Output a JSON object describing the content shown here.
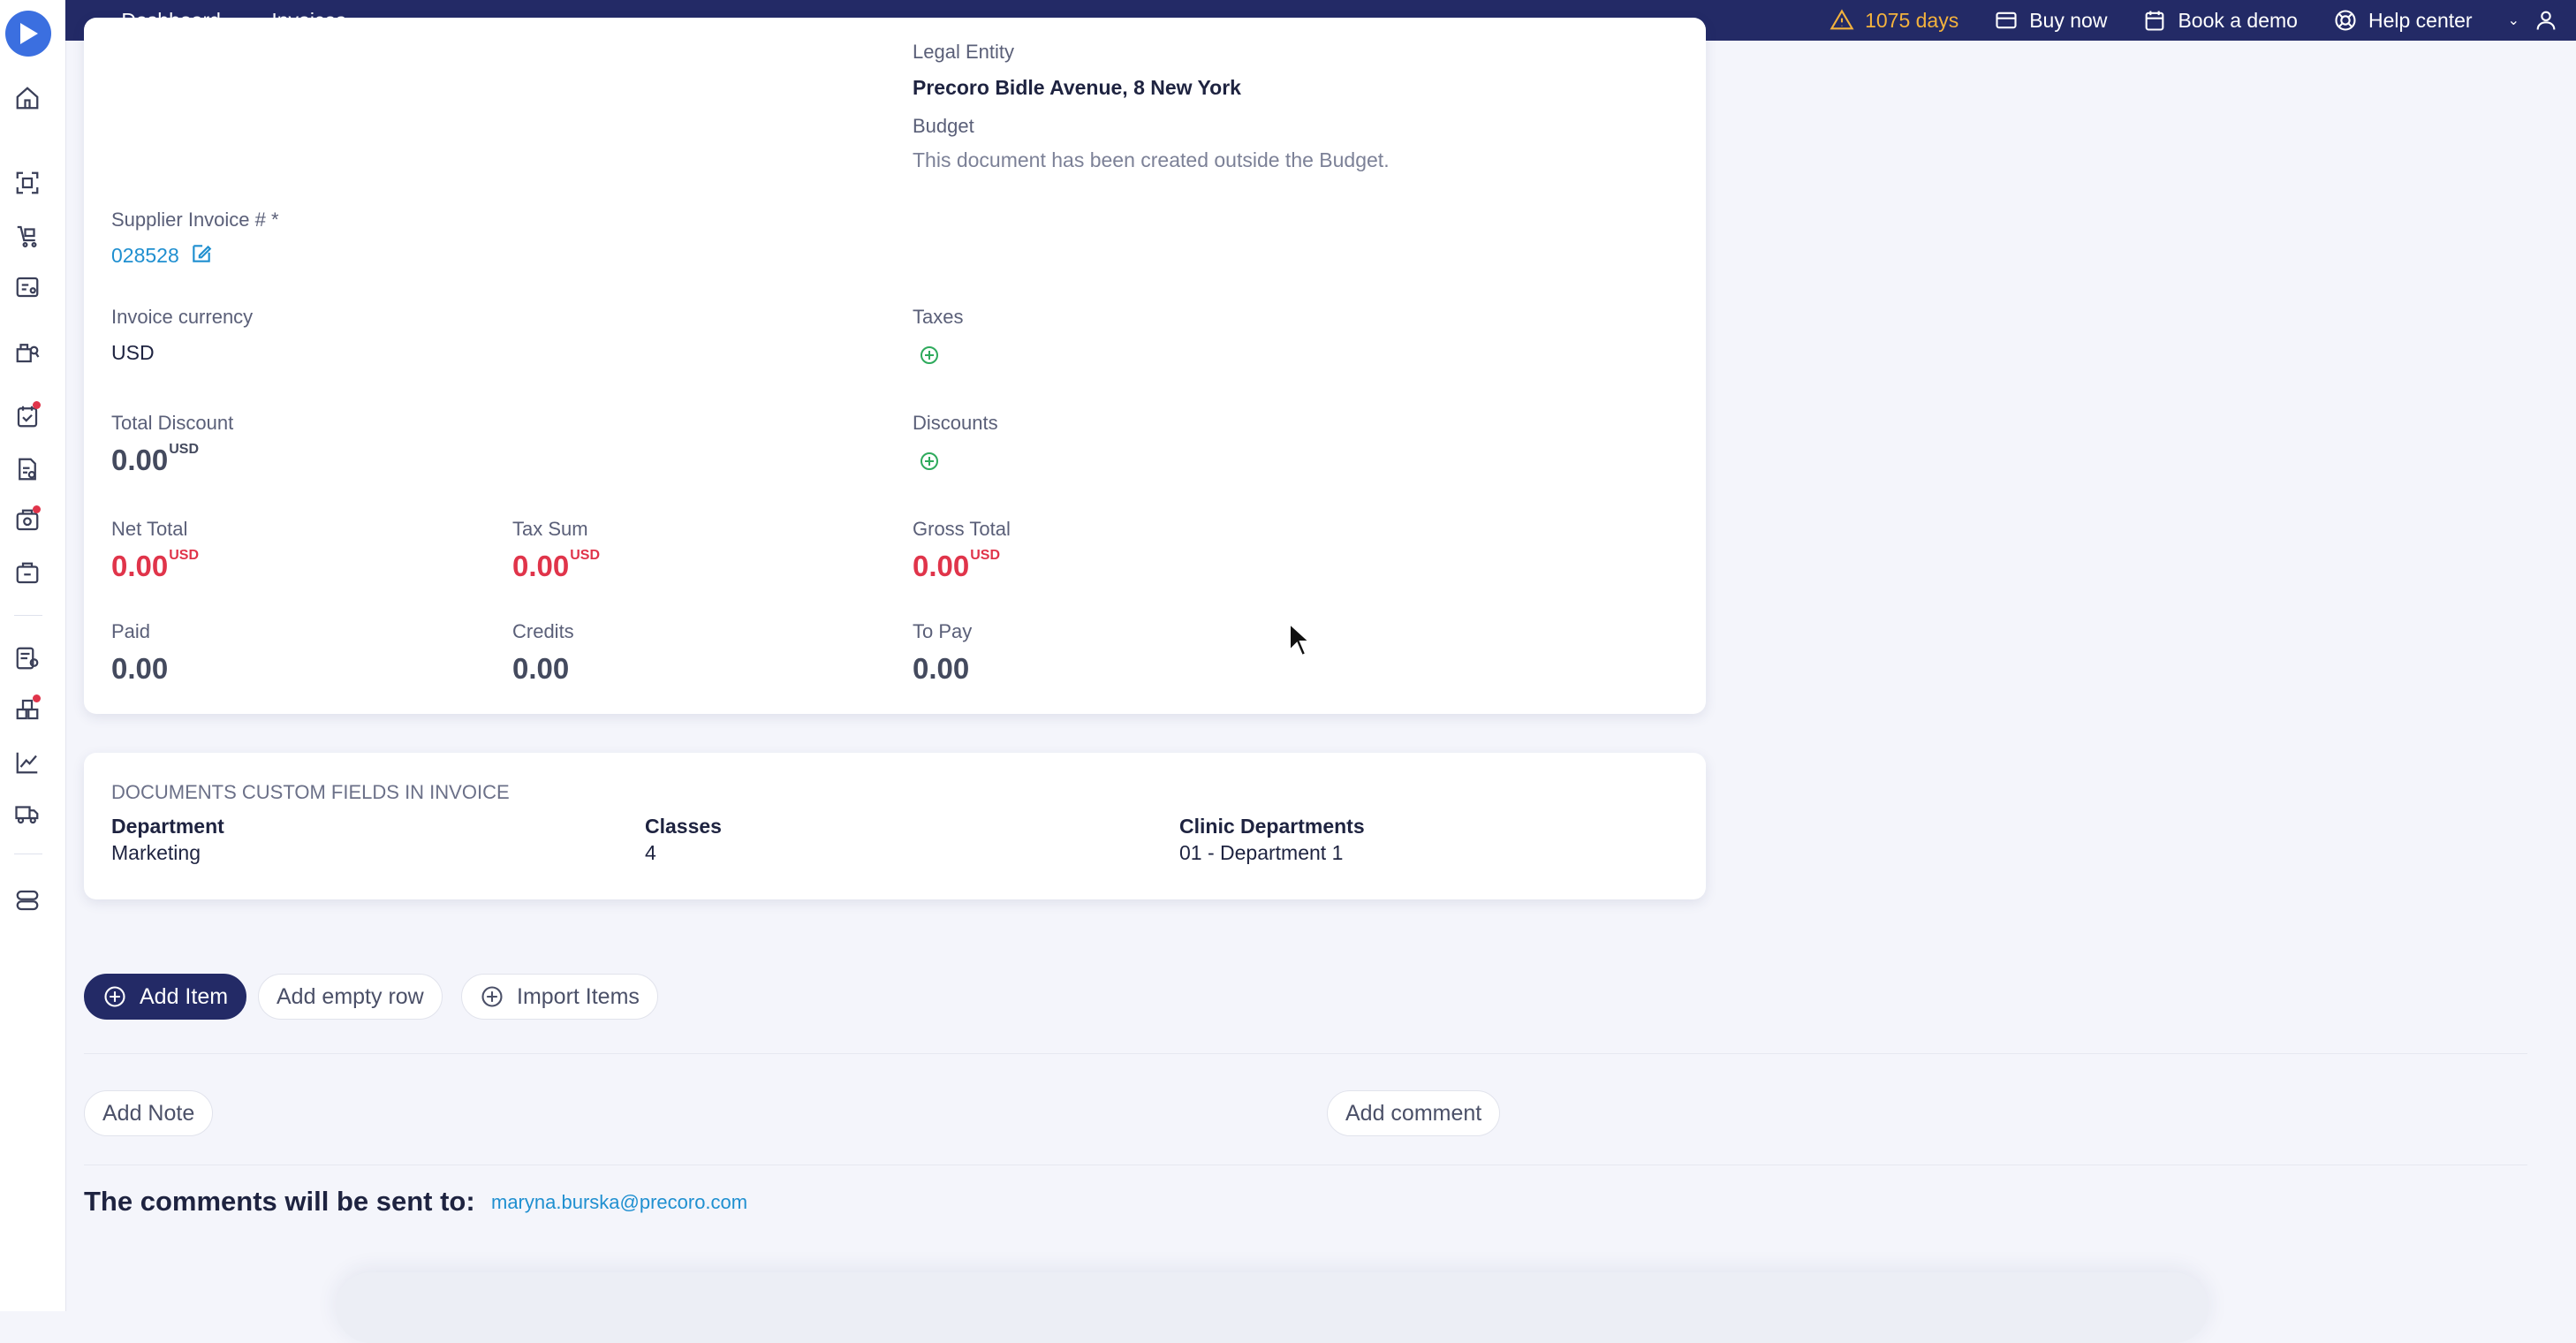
{
  "topbar": {
    "breadcrumb": [
      "Dashboard",
      "Invoices"
    ],
    "trial_days": "1075 days",
    "buy_now": "Buy now",
    "book_demo": "Book a demo",
    "help_center": "Help center"
  },
  "invoice": {
    "legal_entity_label": "Legal Entity",
    "legal_entity_value": "Precoro Bidle Avenue, 8 New York",
    "budget_label": "Budget",
    "budget_value": "This document has been created outside the Budget.",
    "supplier_invoice_label": "Supplier Invoice # *",
    "supplier_invoice_value": "028528",
    "currency_label": "Invoice currency",
    "currency_value": "USD",
    "taxes_label": "Taxes",
    "total_discount_label": "Total Discount",
    "total_discount_value": "0.00",
    "discounts_label": "Discounts",
    "net_total_label": "Net Total",
    "net_total_value": "0.00",
    "tax_sum_label": "Tax Sum",
    "tax_sum_value": "0.00",
    "gross_total_label": "Gross Total",
    "gross_total_value": "0.00",
    "paid_label": "Paid",
    "paid_value": "0.00",
    "credits_label": "Credits",
    "credits_value": "0.00",
    "to_pay_label": "To Pay",
    "to_pay_value": "0.00",
    "unit": "USD"
  },
  "custom_fields": {
    "heading": "DOCUMENTS CUSTOM FIELDS IN INVOICE",
    "fields": [
      {
        "label": "Department",
        "value": "Marketing"
      },
      {
        "label": "Classes",
        "value": "4"
      },
      {
        "label": "Clinic Departments",
        "value": "01 - Department 1"
      }
    ]
  },
  "actions": {
    "add_item": "Add Item",
    "add_empty_row": "Add empty row",
    "import_items": "Import Items",
    "add_note": "Add Note",
    "add_comment": "Add comment"
  },
  "comments": {
    "sent_to_label": "The comments will be sent to:",
    "recipient": "maryna.burska@precoro.com"
  },
  "colors": {
    "topbar": "#232a66",
    "accent_red": "#e0344a",
    "link": "#1f8fd0",
    "warning": "#f3b23d"
  }
}
